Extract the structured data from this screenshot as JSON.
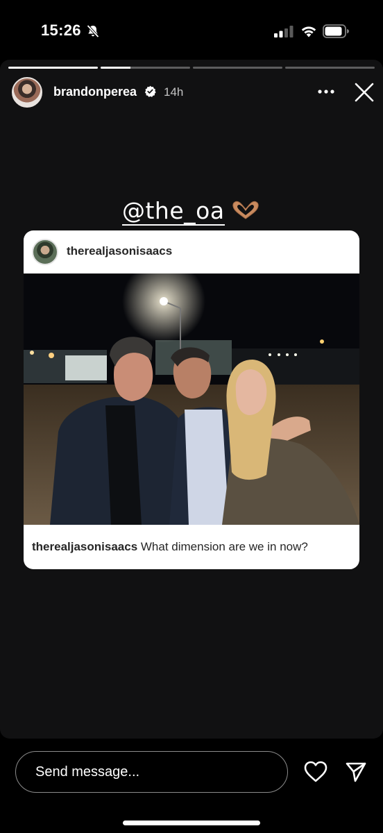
{
  "status_bar": {
    "time": "15:26",
    "icons": [
      "bell-slash-icon",
      "cellular-signal-icon",
      "wifi-icon",
      "battery-icon"
    ]
  },
  "story": {
    "progress_segments": [
      1.0,
      0.33,
      0.0,
      0.0
    ],
    "author": {
      "username": "brandonperea",
      "verified": true,
      "time_ago": "14h"
    },
    "header_icons": [
      "more-options-icon",
      "close-icon"
    ],
    "mention_sticker": {
      "text": "@the_oa",
      "emoji": "🫶🏽"
    },
    "shared_post": {
      "username": "therealjasonisaacs",
      "caption_user": "therealjasonisaacs",
      "caption_text": " What dimension are we in now?"
    }
  },
  "reply_bar": {
    "placeholder": "Send message...",
    "icons": [
      "heart-icon",
      "send-icon"
    ]
  }
}
